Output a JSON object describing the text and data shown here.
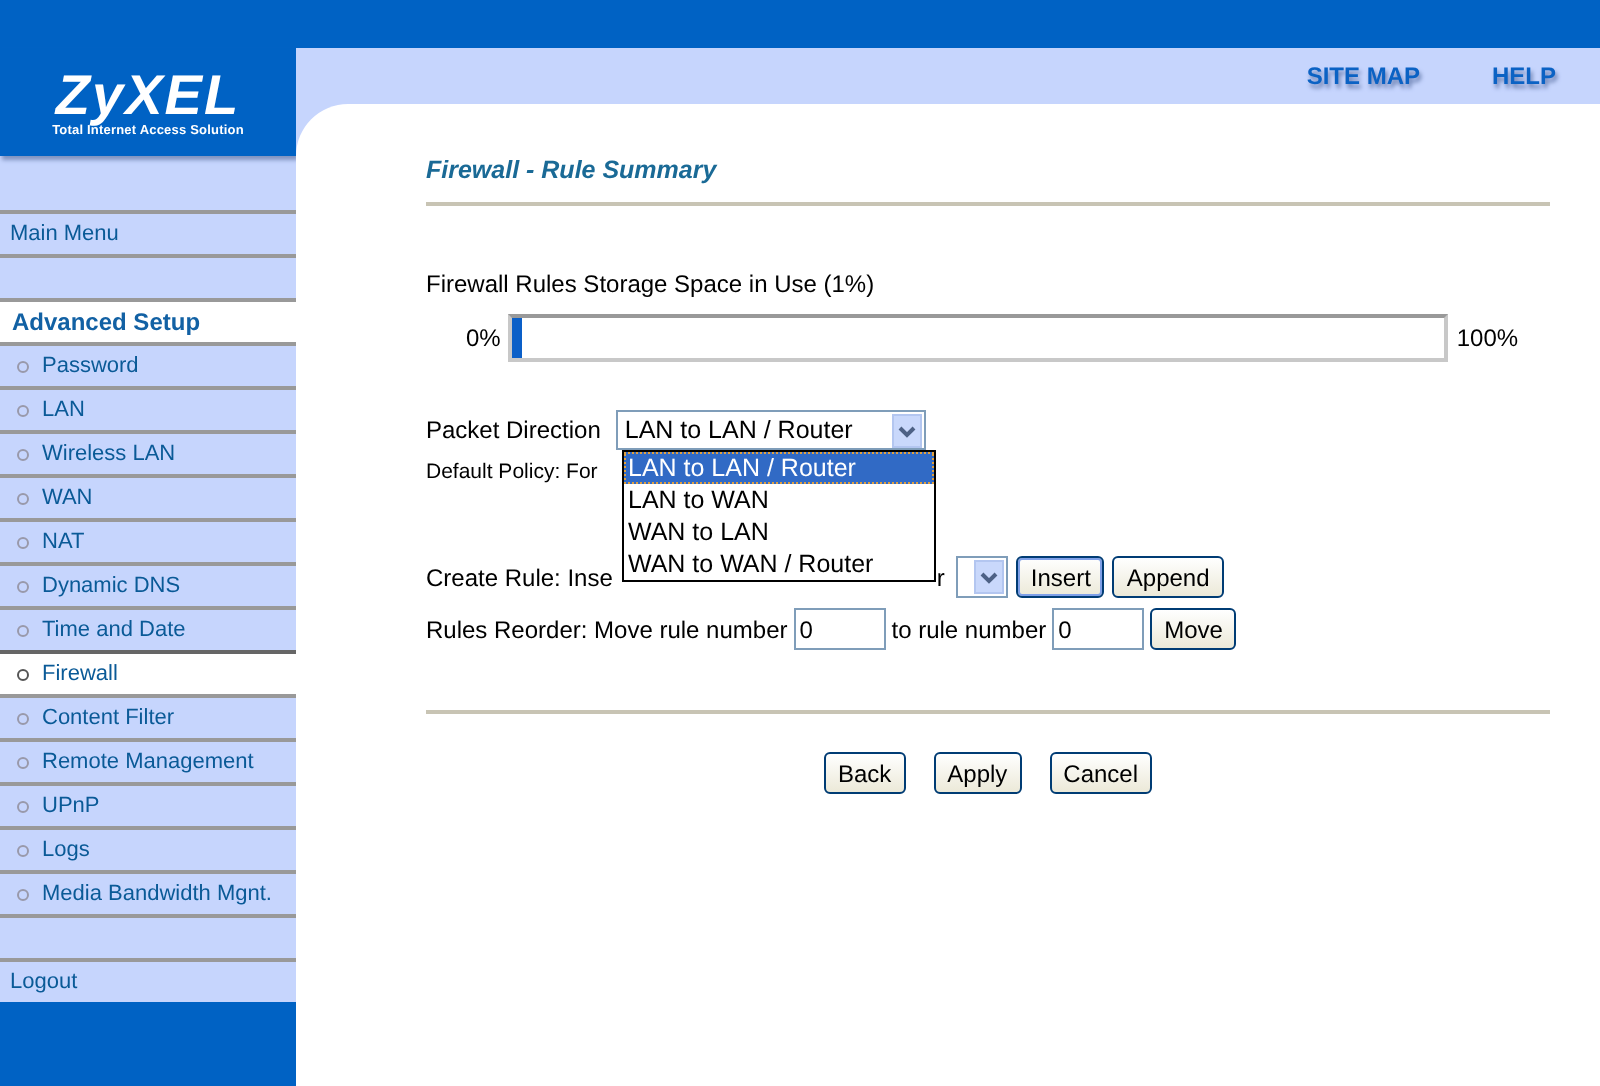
{
  "logo": {
    "name": "ZyXEL",
    "tagline": "Total Internet Access Solution"
  },
  "top_links": [
    "SITE MAP",
    "HELP"
  ],
  "sidebar": {
    "main_menu": "Main Menu",
    "section": "Advanced Setup",
    "items": [
      {
        "label": "Password",
        "selected": false
      },
      {
        "label": "LAN",
        "selected": false
      },
      {
        "label": "Wireless LAN",
        "selected": false
      },
      {
        "label": "WAN",
        "selected": false
      },
      {
        "label": "NAT",
        "selected": false
      },
      {
        "label": "Dynamic DNS",
        "selected": false
      },
      {
        "label": "Time and Date",
        "selected": false
      },
      {
        "label": "Firewall",
        "selected": true
      },
      {
        "label": "Content Filter",
        "selected": false
      },
      {
        "label": "Remote Management",
        "selected": false
      },
      {
        "label": "UPnP",
        "selected": false
      },
      {
        "label": "Logs",
        "selected": false
      },
      {
        "label": "Media Bandwidth Mgnt.",
        "selected": false
      }
    ],
    "logout": "Logout"
  },
  "title": "Firewall - Rule Summary",
  "storage": {
    "label": "Firewall Rules Storage Space in Use  (1%)",
    "min": "0%",
    "max": "100%",
    "level": 0.01
  },
  "packet_direction": {
    "label": "Packet Direction",
    "value": "LAN to LAN / Router",
    "expanded": true,
    "options": [
      {
        "label": "LAN to LAN / Router",
        "selected": true
      },
      {
        "label": "LAN to WAN",
        "selected": false
      },
      {
        "label": "WAN to LAN",
        "selected": false
      },
      {
        "label": "WAN to WAN / Router",
        "selected": false
      }
    ]
  },
  "default_policy": "Default Policy: For",
  "create_rule": {
    "label_start": "Create Rule: Inse",
    "label_end": "r",
    "buttons": [
      "Insert",
      "Append"
    ]
  },
  "reorder": {
    "label": "Rules Reorder: Move rule number",
    "from": "0",
    "middle": "to rule number",
    "to": "0",
    "button": "Move"
  },
  "buttons": [
    "Back",
    "Apply",
    "Cancel"
  ]
}
